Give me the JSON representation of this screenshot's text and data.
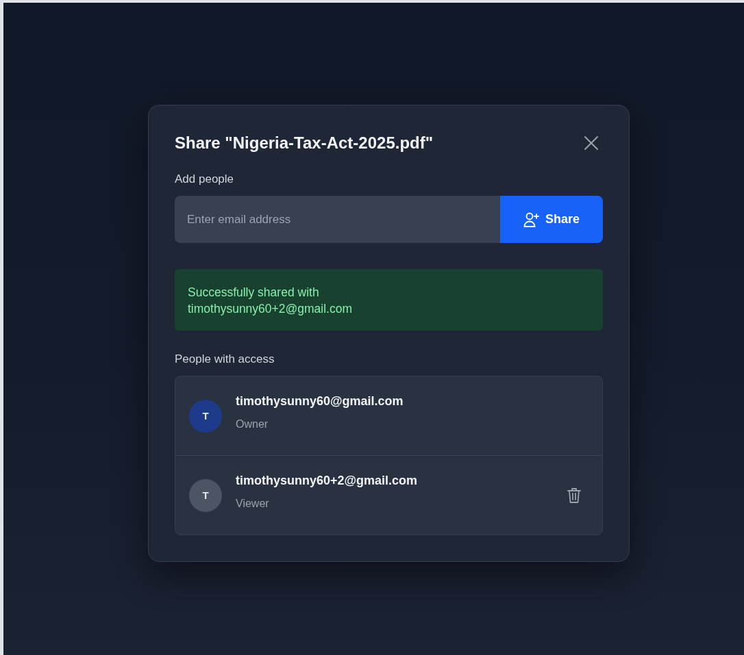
{
  "dialog": {
    "title": "Share \"Nigeria-Tax-Act-2025.pdf\"",
    "add_people": {
      "label": "Add people",
      "placeholder": "Enter email address",
      "button": "Share"
    },
    "success_message": "Successfully shared with timothysunny60+2@gmail.com",
    "access": {
      "label": "People with access",
      "people": [
        {
          "initial": "T",
          "color": "#1e3a8a",
          "email": "timothysunny60@gmail.com",
          "role": "Owner",
          "removable": false
        },
        {
          "initial": "T",
          "color": "#4b5563",
          "email": "timothysunny60+2@gmail.com",
          "role": "Viewer",
          "removable": true
        }
      ]
    }
  }
}
